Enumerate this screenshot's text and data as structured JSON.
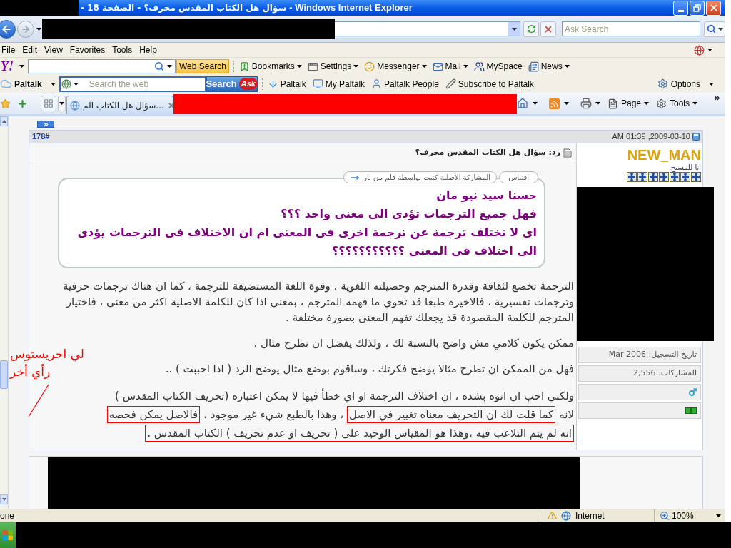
{
  "window": {
    "title": "سؤال هل الكتاب المقدس محرف؟ - الصفحة 18 -",
    "title_suffix": "- Windows Internet Explorer"
  },
  "address_bar": {
    "search_placeholder": "Ask Search"
  },
  "menu": [
    "Help",
    "Tools",
    "Favorites",
    "View",
    "Edit",
    "File"
  ],
  "yahoo_toolbar": {
    "logo": "Y!",
    "search_button": "Web Search",
    "items": [
      {
        "label": "News",
        "has_menu": true
      },
      {
        "label": "MySpace",
        "has_menu": false
      },
      {
        "label": "Mail",
        "has_menu": true
      },
      {
        "label": "Messenger",
        "has_menu": true
      },
      {
        "label": "Settings",
        "has_menu": true
      },
      {
        "label": "Bookmarks",
        "has_menu": true
      }
    ]
  },
  "paltalk_toolbar": {
    "logo": "Paltalk",
    "search_placeholder": "Search the web",
    "search_button": "Search",
    "search_logo": "Ask",
    "links": [
      "Subscribe to Paltalk",
      "Paltalk People",
      "My Paltalk",
      "Paltalk"
    ],
    "options": "Options"
  },
  "tab_bar": {
    "tabs": [
      {
        "title": "سؤال هل الكتاب الم...",
        "selected": true
      }
    ],
    "commands": [
      "Tools",
      "Page"
    ]
  },
  "post": {
    "number": "178#",
    "date": "2009-03-10, 01:39 AM",
    "title": "رد: سؤال هل الكتاب المقدس محرف؟",
    "quote": {
      "label": "اقتباس",
      "attribution": "المشاركة الأصلية كتبت بواسطة قلم من نار",
      "lines": [
        "حسنا سيد نيو مان",
        "فهل جميع الترجمات تؤدى الى معنى واحد ؟؟؟",
        "اى لا تختلف ترجمة عن ترجمة اخرى فى المعنى ام ان الاختلاف فى الترجمات يؤدى الى اختلاف فى المعنى ؟؟؟؟؟؟؟؟؟؟؟"
      ]
    },
    "paragraphs": [
      "الترجمة تخضع لثقافة وقدرة المترجم وحصيلته اللغوية ، وقوة اللغة المستضيفة للترجمة ، كما ان هناك ترجمات حرفية وترجمات تفسيرية ، فالاخيرة طبعا قد تحوي ما فهمه المترجم ، بمعنى اذا كان للكلمة الاصلية اكثر من معنى ، فاختيار المترجم للكلمة المقصودة قد يجعلك تفهم المعنى بصورة مختلفة .",
      "ممكن يكون كلامي مش واضح بالنسبة لك ، ولذلك يفضل ان نطرح مثال .",
      "فهل من الممكن ان تطرح مثالا يوضح فكرتك ، وساقوم بوضع مثال يوضح الرد ( اذا احببت ) .."
    ],
    "annotated_paragraph": [
      [
        {
          "text": "ولكني احب ان انوه بشده ، ان اختلاف الترجمة او اي خطأ فيها لا يمكن اعتباره (تحريف الكتاب المقدس )",
          "boxed": false
        }
      ],
      [
        {
          "text": "لانه",
          "boxed": false
        },
        {
          "text": "كما قلت لك ان التحريف معناه تغيير في الاصل",
          "boxed": true
        },
        {
          "text": "، وهذا بالطبع شيء غير موجود ،",
          "boxed": false
        },
        {
          "text": "فالاصل يمكن فحصه",
          "boxed": true
        }
      ],
      [
        {
          "text": "انه لم يتم التلاعب فيه ،وهذا هو المقياس الوحيد على ( تحريف او عدم تحريف ) الكتاب المقدس .",
          "boxed": true
        }
      ]
    ]
  },
  "author": {
    "name": "NEW_MAN",
    "title": "انا للمسيح",
    "stars": 7,
    "details": [
      {
        "kind": "text",
        "text": "تاريخ التسجيل: Mar 2006"
      },
      {
        "kind": "text",
        "text": "المشاركات: 2,556"
      },
      {
        "kind": "gender"
      },
      {
        "kind": "status"
      }
    ]
  },
  "annotation": {
    "lines": [
      "لي اخريستوس",
      "رأي أخر"
    ]
  },
  "status_bar": {
    "status": "one",
    "zone": "Internet",
    "zoom": "100%"
  }
}
